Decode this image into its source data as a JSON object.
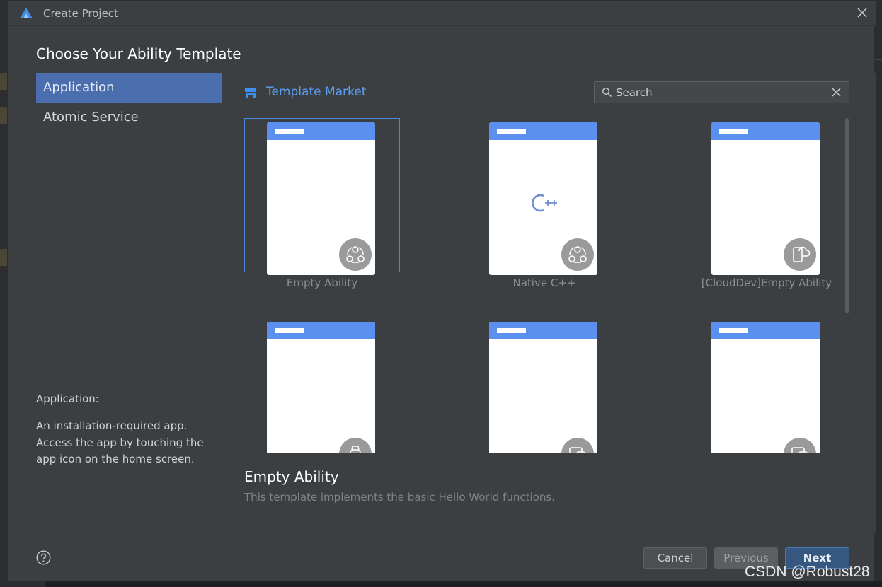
{
  "window": {
    "title": "Create Project",
    "close_icon": "close-icon",
    "logo": "deveco-logo"
  },
  "heading": "Choose Your Ability Template",
  "nav": {
    "items": [
      {
        "label": "Application",
        "active": true
      },
      {
        "label": "Atomic Service",
        "active": false
      }
    ],
    "description_title": "Application:",
    "description": "An installation-required app. Access the app by touching the app icon on the home screen."
  },
  "market": {
    "title": "Template Market",
    "icon": "store-icon"
  },
  "search": {
    "placeholder": "Search",
    "value": ""
  },
  "templates": [
    {
      "label": "Empty Ability",
      "badge": "ability-icon",
      "selected": true
    },
    {
      "label": "Native C++",
      "badge": "ability-icon",
      "content_icon": "cpp-icon",
      "selected": false
    },
    {
      "label": "[CloudDev]Empty Ability",
      "badge": "cloud-device-icon",
      "selected": false
    },
    {
      "label": "",
      "badge": "watch-icon",
      "selected": false
    },
    {
      "label": "",
      "badge": "multi-device-icon",
      "selected": false
    },
    {
      "label": "",
      "badge": "multi-device-icon",
      "selected": false
    }
  ],
  "selected_template": {
    "title": "Empty Ability",
    "description": "This template implements the basic Hello World functions."
  },
  "footer": {
    "help_icon": "help-icon",
    "cancel_label": "Cancel",
    "previous_label": "Previous",
    "next_label": "Next"
  },
  "watermark": "CSDN @Robust28",
  "colors": {
    "accent": "#4b6eaf",
    "market_title": "#5b9ef5",
    "phone_bar": "#5b8ff0",
    "next_button": "#365880",
    "dialog_bg": "#3c3f41"
  }
}
